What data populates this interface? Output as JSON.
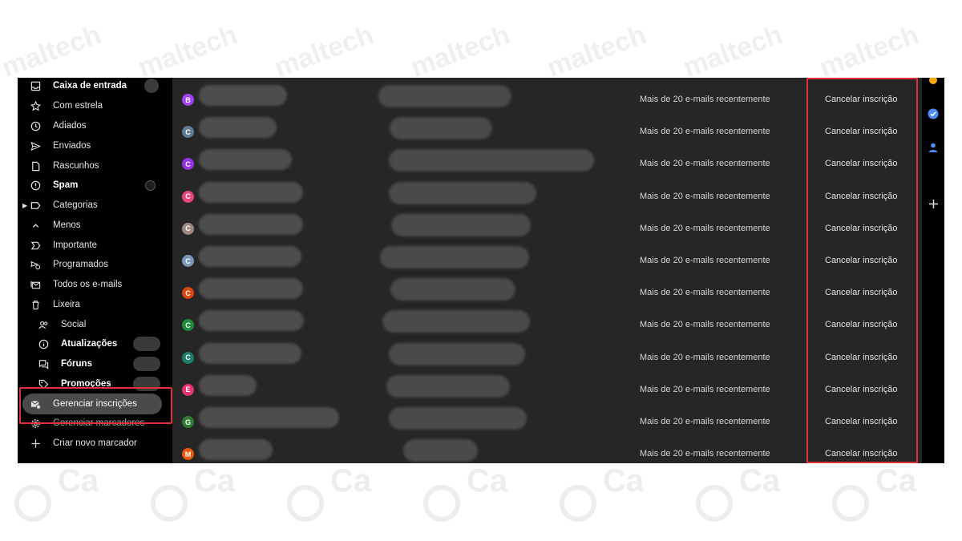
{
  "sidebar": {
    "items": [
      {
        "label": "Caixa de entrada",
        "icon": "inbox-icon"
      },
      {
        "label": "Com estrela",
        "icon": "star-icon"
      },
      {
        "label": "Adiados",
        "icon": "clock-icon"
      },
      {
        "label": "Enviados",
        "icon": "send-icon"
      },
      {
        "label": "Rascunhos",
        "icon": "draft-icon"
      },
      {
        "label": "Spam",
        "icon": "spam-icon"
      },
      {
        "label": "Categorias",
        "icon": "label-icon"
      },
      {
        "label": "Menos",
        "icon": "chevron-up-icon"
      },
      {
        "label": "Importante",
        "icon": "important-icon"
      },
      {
        "label": "Programados",
        "icon": "scheduled-icon"
      },
      {
        "label": "Todos os e-mails",
        "icon": "all-mail-icon"
      },
      {
        "label": "Lixeira",
        "icon": "trash-icon"
      },
      {
        "label": "Social",
        "icon": "people-icon"
      },
      {
        "label": "Atualizações",
        "icon": "info-icon"
      },
      {
        "label": "Fóruns",
        "icon": "forum-icon"
      },
      {
        "label": "Promoções",
        "icon": "tag-icon"
      },
      {
        "label": "Gerenciar inscrições",
        "icon": "manage-subscriptions-icon"
      },
      {
        "label": "Gerenciar marcadores",
        "icon": "gear-icon"
      },
      {
        "label": "Criar novo marcador",
        "icon": "plus-icon"
      }
    ]
  },
  "subscriptions": {
    "frequency_label": "Mais de 20 e-mails recentemente",
    "unsubscribe_label": "Cancelar inscrição",
    "rows": [
      {
        "initial": "B",
        "color": "#a142f4"
      },
      {
        "initial": "C",
        "color": "#5f7d95"
      },
      {
        "initial": "C",
        "color": "#9334e6"
      },
      {
        "initial": "C",
        "color": "#e8457a"
      },
      {
        "initial": "C",
        "color": "#a1887f"
      },
      {
        "initial": "C",
        "color": "#7b97b8"
      },
      {
        "initial": "C",
        "color": "#d9480f"
      },
      {
        "initial": "C",
        "color": "#1e8e3e"
      },
      {
        "initial": "C",
        "color": "#1e7d6b"
      },
      {
        "initial": "E",
        "color": "#e8336e"
      },
      {
        "initial": "G",
        "color": "#2e7d32"
      },
      {
        "initial": "M",
        "color": "#e8590c"
      }
    ]
  },
  "colors": {
    "highlight": "#e0313b",
    "list_background": "#262626",
    "sidebar_background": "#000000"
  }
}
